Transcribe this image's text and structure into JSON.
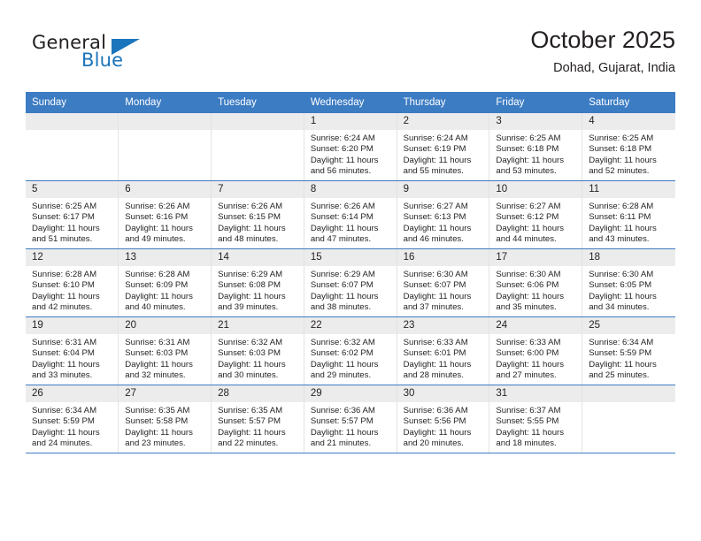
{
  "brand": {
    "name_top": "General",
    "name_bottom": "Blue",
    "triangle_color": "#1b75bc"
  },
  "header": {
    "title": "October 2025",
    "location": "Dohad, Gujarat, India"
  },
  "colors": {
    "header_blue": "#3c7cc3",
    "daynum_band": "#ececec",
    "text": "#231f20"
  },
  "weekday_headers": [
    "Sunday",
    "Monday",
    "Tuesday",
    "Wednesday",
    "Thursday",
    "Friday",
    "Saturday"
  ],
  "labels": {
    "sunrise_prefix": "Sunrise:",
    "sunset_prefix": "Sunset:",
    "daylight_prefix": "Daylight:"
  },
  "weeks": [
    [
      {
        "day": "",
        "empty": true
      },
      {
        "day": "",
        "empty": true
      },
      {
        "day": "",
        "empty": true
      },
      {
        "day": "1",
        "sunrise": "Sunrise: 6:24 AM",
        "sunset": "Sunset: 6:20 PM",
        "daylight_line1": "Daylight: 11 hours",
        "daylight_line2": "and 56 minutes."
      },
      {
        "day": "2",
        "sunrise": "Sunrise: 6:24 AM",
        "sunset": "Sunset: 6:19 PM",
        "daylight_line1": "Daylight: 11 hours",
        "daylight_line2": "and 55 minutes."
      },
      {
        "day": "3",
        "sunrise": "Sunrise: 6:25 AM",
        "sunset": "Sunset: 6:18 PM",
        "daylight_line1": "Daylight: 11 hours",
        "daylight_line2": "and 53 minutes."
      },
      {
        "day": "4",
        "sunrise": "Sunrise: 6:25 AM",
        "sunset": "Sunset: 6:18 PM",
        "daylight_line1": "Daylight: 11 hours",
        "daylight_line2": "and 52 minutes."
      }
    ],
    [
      {
        "day": "5",
        "sunrise": "Sunrise: 6:25 AM",
        "sunset": "Sunset: 6:17 PM",
        "daylight_line1": "Daylight: 11 hours",
        "daylight_line2": "and 51 minutes."
      },
      {
        "day": "6",
        "sunrise": "Sunrise: 6:26 AM",
        "sunset": "Sunset: 6:16 PM",
        "daylight_line1": "Daylight: 11 hours",
        "daylight_line2": "and 49 minutes."
      },
      {
        "day": "7",
        "sunrise": "Sunrise: 6:26 AM",
        "sunset": "Sunset: 6:15 PM",
        "daylight_line1": "Daylight: 11 hours",
        "daylight_line2": "and 48 minutes."
      },
      {
        "day": "8",
        "sunrise": "Sunrise: 6:26 AM",
        "sunset": "Sunset: 6:14 PM",
        "daylight_line1": "Daylight: 11 hours",
        "daylight_line2": "and 47 minutes."
      },
      {
        "day": "9",
        "sunrise": "Sunrise: 6:27 AM",
        "sunset": "Sunset: 6:13 PM",
        "daylight_line1": "Daylight: 11 hours",
        "daylight_line2": "and 46 minutes."
      },
      {
        "day": "10",
        "sunrise": "Sunrise: 6:27 AM",
        "sunset": "Sunset: 6:12 PM",
        "daylight_line1": "Daylight: 11 hours",
        "daylight_line2": "and 44 minutes."
      },
      {
        "day": "11",
        "sunrise": "Sunrise: 6:28 AM",
        "sunset": "Sunset: 6:11 PM",
        "daylight_line1": "Daylight: 11 hours",
        "daylight_line2": "and 43 minutes."
      }
    ],
    [
      {
        "day": "12",
        "sunrise": "Sunrise: 6:28 AM",
        "sunset": "Sunset: 6:10 PM",
        "daylight_line1": "Daylight: 11 hours",
        "daylight_line2": "and 42 minutes."
      },
      {
        "day": "13",
        "sunrise": "Sunrise: 6:28 AM",
        "sunset": "Sunset: 6:09 PM",
        "daylight_line1": "Daylight: 11 hours",
        "daylight_line2": "and 40 minutes."
      },
      {
        "day": "14",
        "sunrise": "Sunrise: 6:29 AM",
        "sunset": "Sunset: 6:08 PM",
        "daylight_line1": "Daylight: 11 hours",
        "daylight_line2": "and 39 minutes."
      },
      {
        "day": "15",
        "sunrise": "Sunrise: 6:29 AM",
        "sunset": "Sunset: 6:07 PM",
        "daylight_line1": "Daylight: 11 hours",
        "daylight_line2": "and 38 minutes."
      },
      {
        "day": "16",
        "sunrise": "Sunrise: 6:30 AM",
        "sunset": "Sunset: 6:07 PM",
        "daylight_line1": "Daylight: 11 hours",
        "daylight_line2": "and 37 minutes."
      },
      {
        "day": "17",
        "sunrise": "Sunrise: 6:30 AM",
        "sunset": "Sunset: 6:06 PM",
        "daylight_line1": "Daylight: 11 hours",
        "daylight_line2": "and 35 minutes."
      },
      {
        "day": "18",
        "sunrise": "Sunrise: 6:30 AM",
        "sunset": "Sunset: 6:05 PM",
        "daylight_line1": "Daylight: 11 hours",
        "daylight_line2": "and 34 minutes."
      }
    ],
    [
      {
        "day": "19",
        "sunrise": "Sunrise: 6:31 AM",
        "sunset": "Sunset: 6:04 PM",
        "daylight_line1": "Daylight: 11 hours",
        "daylight_line2": "and 33 minutes."
      },
      {
        "day": "20",
        "sunrise": "Sunrise: 6:31 AM",
        "sunset": "Sunset: 6:03 PM",
        "daylight_line1": "Daylight: 11 hours",
        "daylight_line2": "and 32 minutes."
      },
      {
        "day": "21",
        "sunrise": "Sunrise: 6:32 AM",
        "sunset": "Sunset: 6:03 PM",
        "daylight_line1": "Daylight: 11 hours",
        "daylight_line2": "and 30 minutes."
      },
      {
        "day": "22",
        "sunrise": "Sunrise: 6:32 AM",
        "sunset": "Sunset: 6:02 PM",
        "daylight_line1": "Daylight: 11 hours",
        "daylight_line2": "and 29 minutes."
      },
      {
        "day": "23",
        "sunrise": "Sunrise: 6:33 AM",
        "sunset": "Sunset: 6:01 PM",
        "daylight_line1": "Daylight: 11 hours",
        "daylight_line2": "and 28 minutes."
      },
      {
        "day": "24",
        "sunrise": "Sunrise: 6:33 AM",
        "sunset": "Sunset: 6:00 PM",
        "daylight_line1": "Daylight: 11 hours",
        "daylight_line2": "and 27 minutes."
      },
      {
        "day": "25",
        "sunrise": "Sunrise: 6:34 AM",
        "sunset": "Sunset: 5:59 PM",
        "daylight_line1": "Daylight: 11 hours",
        "daylight_line2": "and 25 minutes."
      }
    ],
    [
      {
        "day": "26",
        "sunrise": "Sunrise: 6:34 AM",
        "sunset": "Sunset: 5:59 PM",
        "daylight_line1": "Daylight: 11 hours",
        "daylight_line2": "and 24 minutes."
      },
      {
        "day": "27",
        "sunrise": "Sunrise: 6:35 AM",
        "sunset": "Sunset: 5:58 PM",
        "daylight_line1": "Daylight: 11 hours",
        "daylight_line2": "and 23 minutes."
      },
      {
        "day": "28",
        "sunrise": "Sunrise: 6:35 AM",
        "sunset": "Sunset: 5:57 PM",
        "daylight_line1": "Daylight: 11 hours",
        "daylight_line2": "and 22 minutes."
      },
      {
        "day": "29",
        "sunrise": "Sunrise: 6:36 AM",
        "sunset": "Sunset: 5:57 PM",
        "daylight_line1": "Daylight: 11 hours",
        "daylight_line2": "and 21 minutes."
      },
      {
        "day": "30",
        "sunrise": "Sunrise: 6:36 AM",
        "sunset": "Sunset: 5:56 PM",
        "daylight_line1": "Daylight: 11 hours",
        "daylight_line2": "and 20 minutes."
      },
      {
        "day": "31",
        "sunrise": "Sunrise: 6:37 AM",
        "sunset": "Sunset: 5:55 PM",
        "daylight_line1": "Daylight: 11 hours",
        "daylight_line2": "and 18 minutes."
      },
      {
        "day": "",
        "empty": true
      }
    ]
  ]
}
